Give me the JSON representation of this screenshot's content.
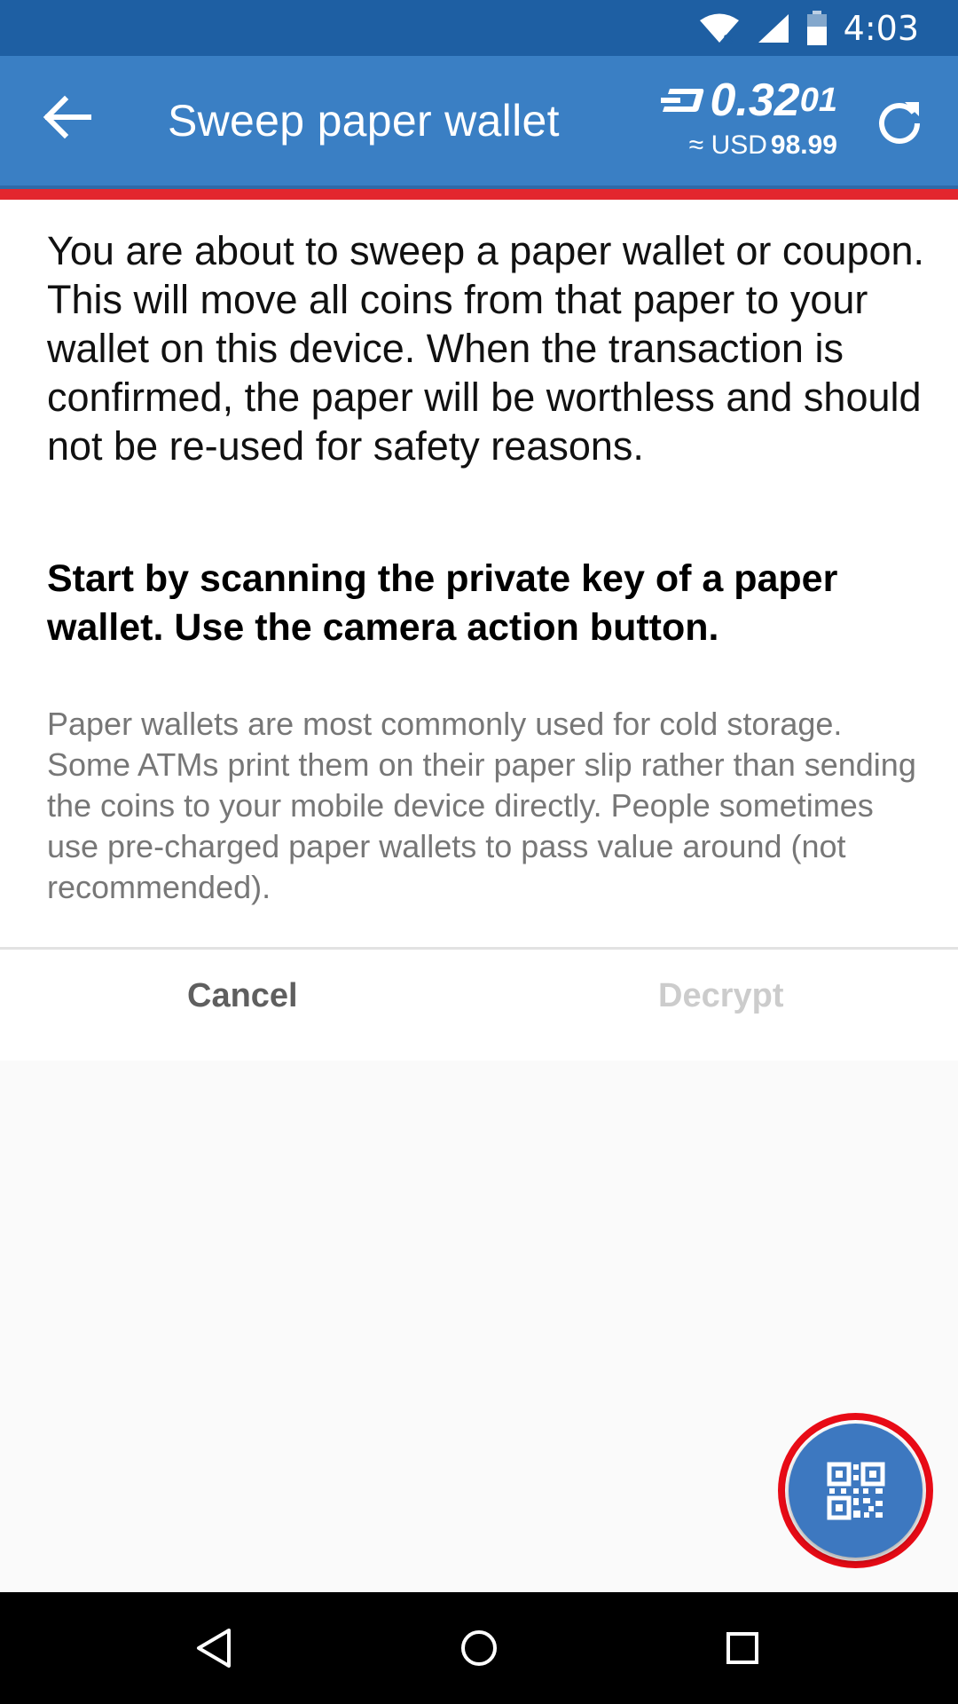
{
  "status_bar": {
    "time": "4:03",
    "icons": [
      "wifi-icon",
      "signal-icon",
      "battery-icon"
    ]
  },
  "app_bar": {
    "back_icon": "arrow-left-icon",
    "title": "Sweep paper wallet",
    "balance": {
      "currency_icon": "dash-icon",
      "amount_main": "0.32",
      "amount_small": "01",
      "fiat_prefix": "≈ USD",
      "fiat_value": "98.99"
    },
    "refresh_icon": "refresh-icon"
  },
  "content": {
    "intro": "You are about to sweep a paper wallet or coupon. This will move all coins from that paper to your wallet on this device. When the transaction is confirmed, the paper will be worthless and should not be re-used for safety reasons.",
    "instruction": "Start by scanning the private key of a paper wallet. Use the camera action button.",
    "note": "Paper wallets are most commonly used for cold storage. Some ATMs print them on their paper slip rather than sending the coins to your mobile device directly. People sometimes use pre-charged paper wallets to pass value around (not recommended)."
  },
  "actions": {
    "cancel": "Cancel",
    "decrypt": "Decrypt"
  },
  "fab": {
    "icon": "qr-code-icon"
  },
  "nav_bar": {
    "icons": [
      "back-triangle-icon",
      "home-circle-icon",
      "recents-square-icon"
    ]
  },
  "colors": {
    "status_bar": "#1e5fa3",
    "app_bar": "#3a7fc4",
    "accent_red": "#e3262e",
    "fab": "#3d78c0"
  }
}
